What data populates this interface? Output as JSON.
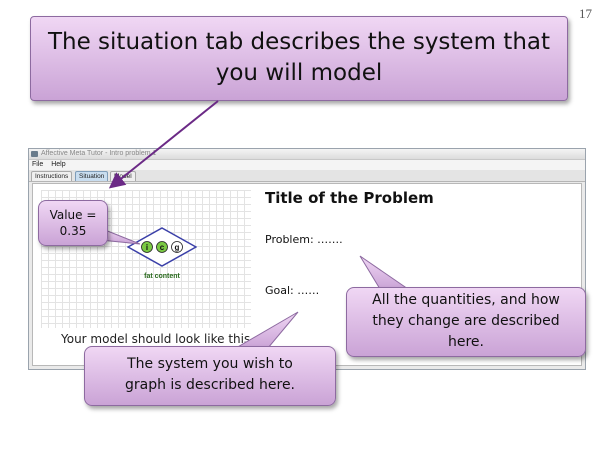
{
  "slide_number": "17",
  "title_callout": {
    "line1": "The situation tab describes the system that",
    "line2": "you will model"
  },
  "app_window": {
    "title": "Affective Meta Tutor - Intro problem 1",
    "menu": [
      "File",
      "Help"
    ],
    "tabs": [
      {
        "label": "Instructions",
        "active": false
      },
      {
        "label": "Situation",
        "active": true
      },
      {
        "label": "Model",
        "active": false
      }
    ]
  },
  "model_preview": {
    "node_letters": [
      "i",
      "c",
      "g"
    ],
    "node_label": "fat content",
    "caption": "Your model should look like this."
  },
  "problem_panel": {
    "title": "Title of the Problem",
    "problem": "Problem: …….",
    "goal": "Goal: ……"
  },
  "callouts": {
    "value": {
      "line1": "Value =",
      "line2": "0.35"
    },
    "quantities": {
      "line1": "All the quantities, and how",
      "line2": "they change are described",
      "line3": "here."
    },
    "system": {
      "line1": "The system you wish to",
      "line2": "graph is described here."
    }
  },
  "colors": {
    "callout_top": "#f0d7f4",
    "callout_bottom": "#caa3d6",
    "arrow": "#6b2a86",
    "node_border": "#3a3fa8",
    "node_circle": "#7ac943",
    "active_tab": "#c9ddef"
  }
}
